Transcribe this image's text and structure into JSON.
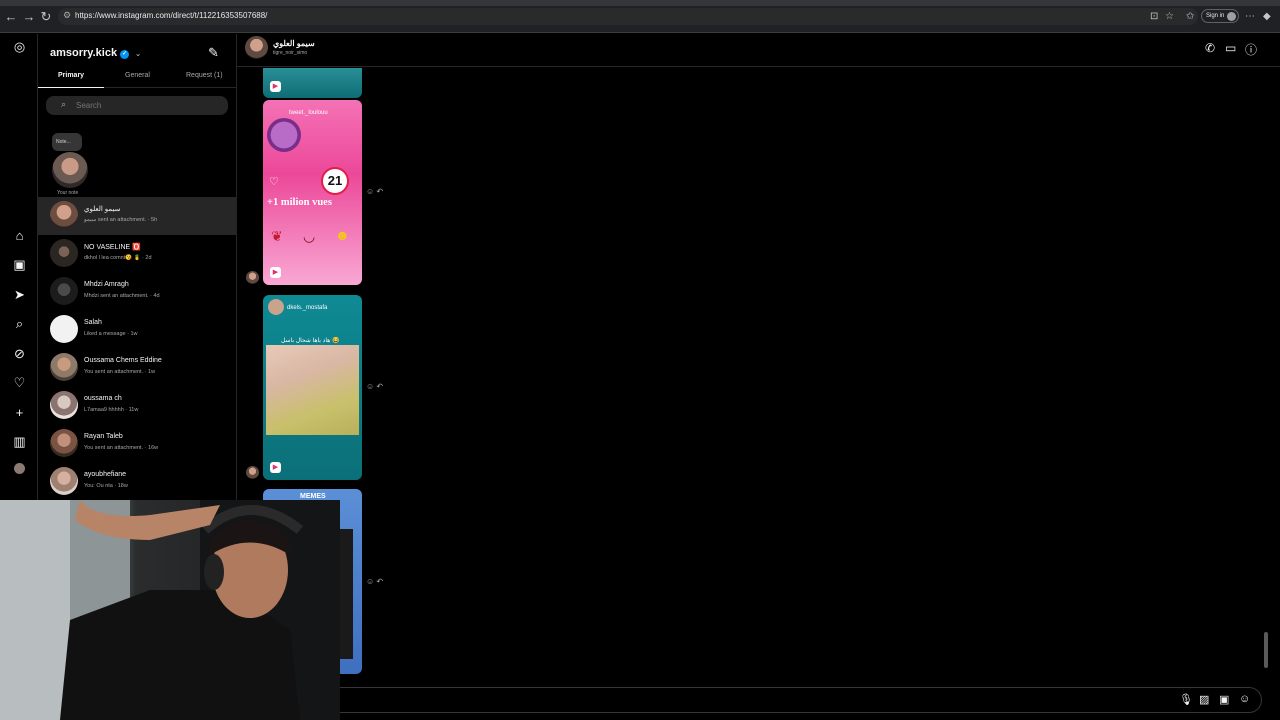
{
  "browser": {
    "url": "https://www.instagram.com/direct/t/112216353507688/",
    "signin_label": "Sign in"
  },
  "inbox": {
    "account_name": "amsorry.kick",
    "tabs": [
      {
        "label": "Primary"
      },
      {
        "label": "General"
      },
      {
        "label": "Request (1)"
      }
    ],
    "search_placeholder": "Search",
    "note_bubble": "Note...",
    "note_label": "Your note",
    "conversations": [
      {
        "name": "سيمو العلوي",
        "preview": "سيمو sent an attachment. · 5h",
        "selected": true
      },
      {
        "name": "NO VASELINE 🅾️",
        "preview": "dkhol l lea comnt😘 🍍 · 2d"
      },
      {
        "name": "Mhdzi Amragh",
        "preview": "Mhdzi sent an attachment. · 4d"
      },
      {
        "name": "Salah",
        "preview": "Liked a message · 1w"
      },
      {
        "name": "Oussama Chems Eddine",
        "preview": "You sent an attachment. · 1w"
      },
      {
        "name": "oussama ch",
        "preview": "L7amaa9 hhhhh · 11w"
      },
      {
        "name": "Rayan Taleb",
        "preview": "You sent an attachment. · 16w"
      },
      {
        "name": "ayoubhefiane",
        "preview": "You: Ou nta · 18w"
      }
    ]
  },
  "chat": {
    "name": "سيمو العلوي",
    "username": "tigre_noir_simo"
  },
  "messages": {
    "card1": {
      "username": "tweet._loulouu",
      "stat": "+1 milion vues",
      "age": "21"
    },
    "card2": {
      "username": "dkels._mostafa",
      "caption": "هاد باها شحال باسل 😂"
    },
    "card3": {
      "title": "MEMES"
    }
  },
  "colors": {
    "background": "#000000",
    "accent_verified": "#0095f6",
    "card_pink": "#ec4899",
    "card_teal": "#0f8a94"
  },
  "icons": [
    "instagram-icon",
    "home-icon",
    "reels-icon",
    "messages-icon",
    "search-icon",
    "explore-icon",
    "heart-icon",
    "create-icon",
    "dashboard-icon",
    "phone-icon",
    "video-icon",
    "info-icon",
    "microphone-icon",
    "image-icon",
    "sticker-icon"
  ]
}
